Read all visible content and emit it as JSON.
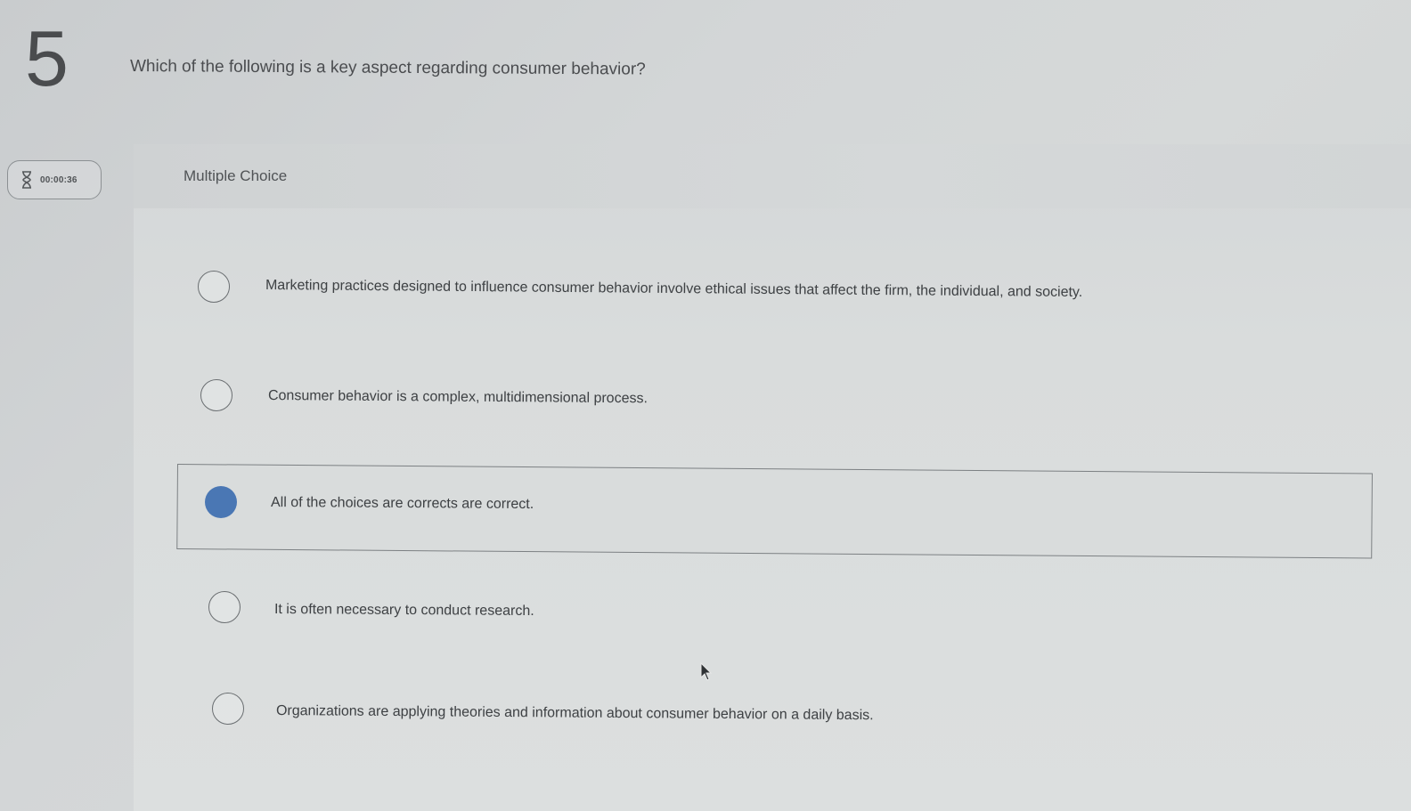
{
  "question": {
    "number": "5",
    "text": "Which of the following is a key aspect regarding consumer behavior?",
    "type": "Multiple Choice"
  },
  "timer": {
    "icon": "hourglass-icon",
    "value": "00:00:36"
  },
  "options": [
    {
      "label": "Marketing practices designed to influence consumer behavior involve ethical issues that affect the firm, the individual, and society.",
      "selected": false
    },
    {
      "label": "Consumer behavior is a complex, multidimensional process.",
      "selected": false
    },
    {
      "label": "All of the choices are corrects are correct.",
      "selected": true
    },
    {
      "label": "It is often necessary to conduct research.",
      "selected": false
    },
    {
      "label": "Organizations are applying theories and information about consumer behavior on a daily basis.",
      "selected": false
    }
  ],
  "colors": {
    "selected_radio": "#4a77b4",
    "background": "#d3d6d7"
  }
}
